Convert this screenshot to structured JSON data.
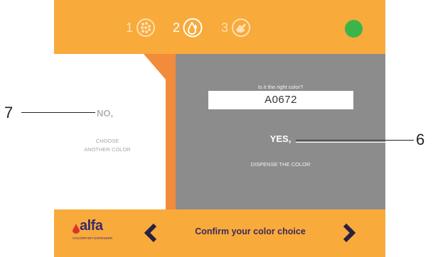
{
  "header": {
    "steps": [
      {
        "number": "1",
        "icon": "dots-palette-icon"
      },
      {
        "number": "2",
        "icon": "drop-icon"
      },
      {
        "number": "3",
        "icon": "hand-icon"
      }
    ],
    "active_step": 2,
    "status_color": "#3bb54a"
  },
  "left": {
    "no_label": "NO,",
    "choose_text": "CHOOSE ANOTHER COLOR"
  },
  "right": {
    "question": "Is it the right color?",
    "color_code": "A0672",
    "yes_label": "YES,",
    "dispense_text": "DISPENSE THE COLOR"
  },
  "footer": {
    "logo_text": "alfa",
    "logo_sub": "COLORPAINT DISPENSER",
    "title": "Confirm your color choice",
    "prev_icon": "chevron-left-icon",
    "next_icon": "chevron-right-icon"
  },
  "annotations": {
    "left_callout": "7",
    "right_callout": "6"
  },
  "colors": {
    "accent_orange": "#f8aa3b",
    "divider_orange": "#f28c3b",
    "panel_gray": "#8c8c8c",
    "text_dark": "#3a2a5a"
  }
}
